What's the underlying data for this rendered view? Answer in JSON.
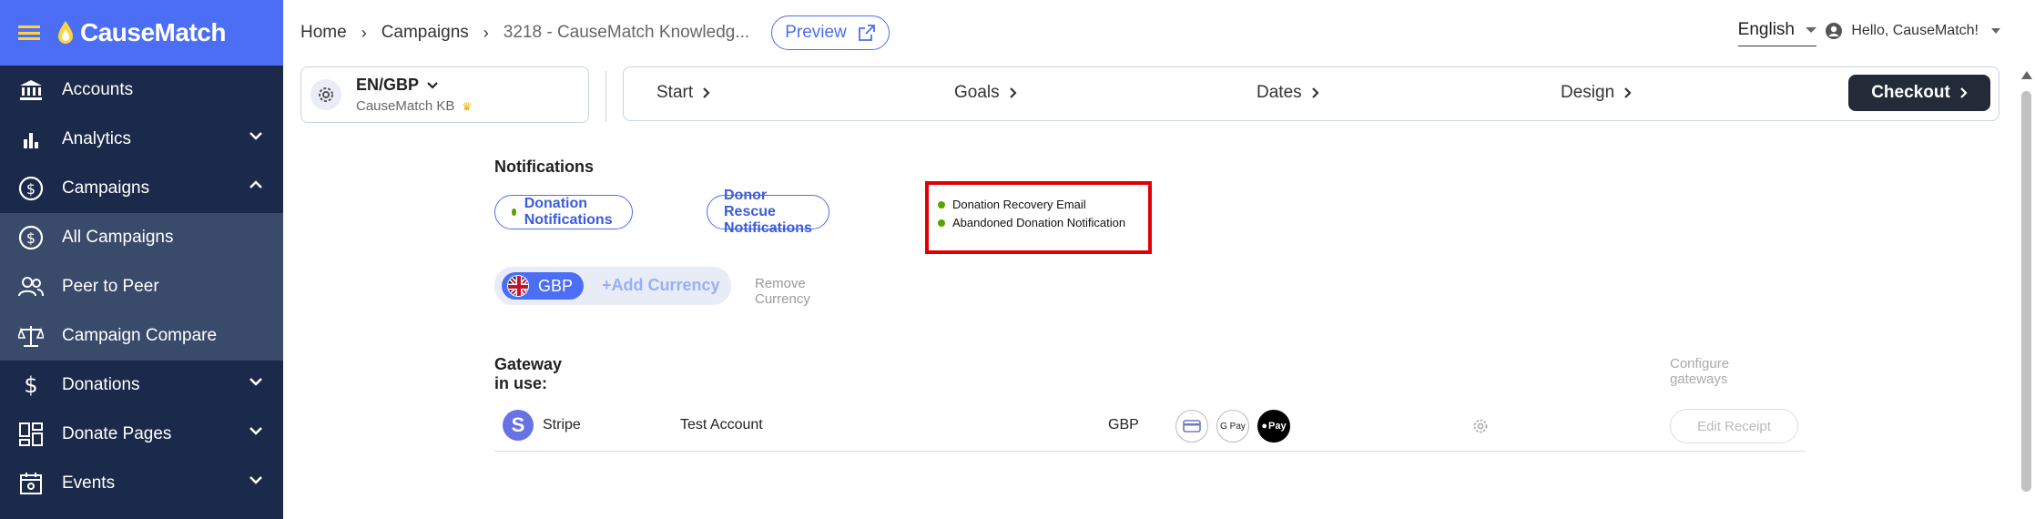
{
  "sidebar": {
    "brand": "CauseMatch",
    "items": [
      {
        "label": "Accounts"
      },
      {
        "label": "Analytics"
      },
      {
        "label": "Campaigns"
      },
      {
        "label": "All Campaigns"
      },
      {
        "label": "Peer to Peer"
      },
      {
        "label": "Campaign Compare"
      },
      {
        "label": "Donations"
      },
      {
        "label": "Donate Pages"
      },
      {
        "label": "Events"
      }
    ]
  },
  "header": {
    "breadcrumb": [
      "Home",
      "Campaigns",
      "3218  -  CauseMatch Knowledg..."
    ],
    "preview_label": "Preview",
    "language": "English",
    "user_greeting": "Hello, CauseMatch!"
  },
  "locale": {
    "code": "EN/GBP",
    "campaign": "CauseMatch KB"
  },
  "steps": [
    "Start",
    "Goals",
    "Dates",
    "Design"
  ],
  "checkout_label": "Checkout",
  "notifications": {
    "title": "Notifications",
    "pills": [
      "Donation Notifications",
      "Donor Rescue Notifications"
    ],
    "highlight_items": [
      "Donation Recovery Email",
      "Abandoned Donation Notification"
    ]
  },
  "currency": {
    "current": "GBP",
    "add_label": "+Add Currency",
    "remove_label": "Remove Currency"
  },
  "gateway": {
    "title": "Gateway in use:",
    "configure_label": "Configure gateways",
    "row": {
      "logo_letter": "S",
      "name": "Stripe",
      "account": "Test Account",
      "currency": "GBP",
      "methods": [
        "card-icon",
        "G Pay",
        "Pay"
      ],
      "edit_label": "Edit Receipt"
    }
  },
  "colors": {
    "sidebar_bg": "#1b2a4a",
    "brand_bg": "#4c6ef5",
    "accent": "#4c6ef5",
    "highlight_border": "#e10000",
    "active_dot": "#5aa100"
  }
}
